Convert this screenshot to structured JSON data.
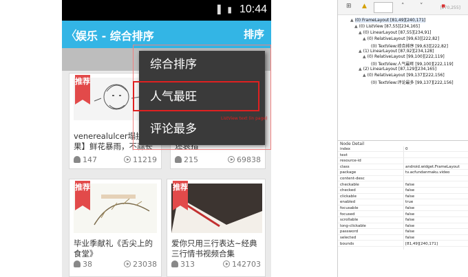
{
  "phone": {
    "status_time": "10:44",
    "status_icons": "▐ ▮",
    "actionbar": {
      "back": "〈",
      "title": "娱乐 - 综合排序",
      "sort": "排序"
    },
    "cards": [
      {
        "ribbon": "推荐",
        "title": "venerealulcer塌拱 苹果】鲜花暴雨，不蒜长",
        "users": "147",
        "plays": "11219"
      },
      {
        "ribbon": "",
        "title": "述哀措",
        "users": "215",
        "plays": "69838"
      },
      {
        "ribbon": "推荐",
        "title": "毕业季献礼《舌尖上的食堂》",
        "users": "38",
        "plays": "23038"
      },
      {
        "ribbon": "推荐",
        "title": "爱你只用三行表达~经典三行情书视频合集",
        "users": "313",
        "plays": "142703"
      }
    ],
    "popup": {
      "items": [
        "综合排序",
        "人气最旺",
        "评论最多"
      ],
      "selected_index": 1,
      "selection_label": "ListView text (in page)"
    }
  },
  "inspector": {
    "coords": "[270,255]",
    "tree": [
      {
        "tag": "▲",
        "text": "(0) FrameLayout [81,49][240,171]"
      },
      {
        "tag": "▲",
        "text": "(0) ListView [87,55][234,165]"
      },
      {
        "tag": "▲",
        "text": "(0) LinearLayout [87,55][234,91]"
      },
      {
        "tag": "▲",
        "text": "(0) RelativeLayout [99,63][222,82]"
      },
      {
        "tag": "",
        "text": "(0) TextView:综合排序 [99,63][222,82]"
      },
      {
        "tag": "▲",
        "text": "(1) LinearLayout [87,92][234,128]"
      },
      {
        "tag": "▲",
        "text": "(0) RelativeLayout [99,100][222,119]"
      },
      {
        "tag": "",
        "text": "(0) TextView:人气最旺 [99,100][222,119]"
      },
      {
        "tag": "▲",
        "text": "(2) LinearLayout [87,129][234,165]"
      },
      {
        "tag": "▲",
        "text": "(0) RelativeLayout [99,137][222,156]"
      },
      {
        "tag": "",
        "text": "(0) TextView:评论最多 [99,137][222,156]"
      }
    ],
    "detail_header": "Node Detail",
    "details": [
      {
        "k": "index",
        "v": "0"
      },
      {
        "k": "text",
        "v": ""
      },
      {
        "k": "resource-id",
        "v": ""
      },
      {
        "k": "class",
        "v": "android.widget.FrameLayout"
      },
      {
        "k": "package",
        "v": "tv.acfundanmaku.video"
      },
      {
        "k": "content-desc",
        "v": ""
      },
      {
        "k": "checkable",
        "v": "false"
      },
      {
        "k": "checked",
        "v": "false"
      },
      {
        "k": "clickable",
        "v": "false"
      },
      {
        "k": "enabled",
        "v": "true"
      },
      {
        "k": "focusable",
        "v": "false"
      },
      {
        "k": "focused",
        "v": "false"
      },
      {
        "k": "scrollable",
        "v": "false"
      },
      {
        "k": "long-clickable",
        "v": "false"
      },
      {
        "k": "password",
        "v": "false"
      },
      {
        "k": "selected",
        "v": "false"
      },
      {
        "k": "bounds",
        "v": "[81,49][240,171]"
      }
    ]
  },
  "colors": {
    "accent": "#33b5e5",
    "ribbon": "#e24a4a",
    "highlight": "#e02020"
  }
}
